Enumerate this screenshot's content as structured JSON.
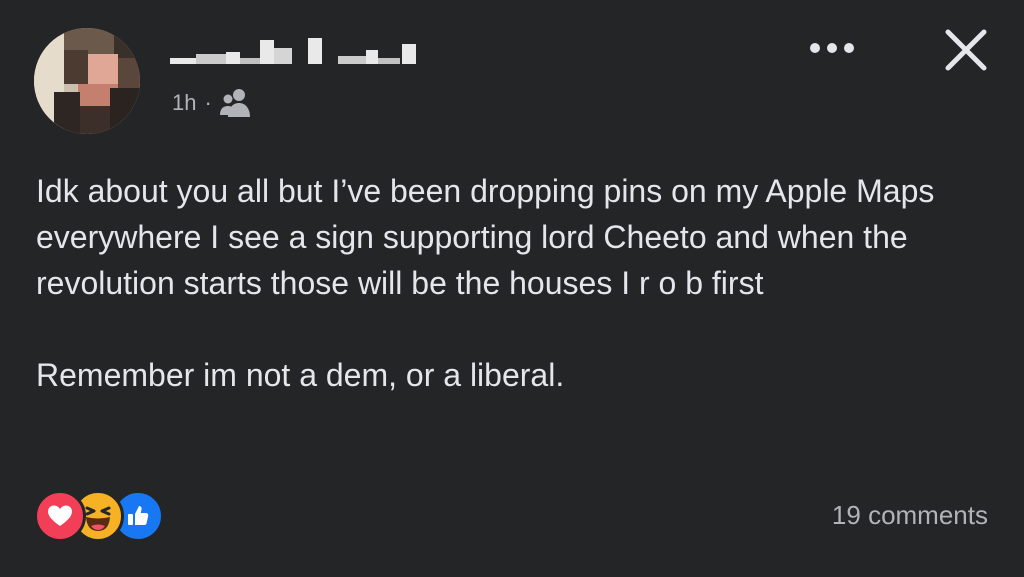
{
  "post": {
    "time": "1h",
    "separator": "·",
    "audience_icon": "friends-icon",
    "text": "Idk about you all but I’ve been dropping pins on my Apple Maps everywhere I see a sign supporting lord Cheeto and when the revolution starts those will be the houses I r o b first\n\nRemember im not a dem, or a liberal."
  },
  "header": {
    "more_icon": "more-options-icon",
    "close_icon": "close-icon"
  },
  "footer": {
    "reactions": [
      "love-reaction-icon",
      "haha-reaction-icon",
      "like-reaction-icon"
    ],
    "comments": "19 comments"
  },
  "colors": {
    "background": "#242526",
    "primary_text": "#e4e6eb",
    "secondary_text": "#b0b3b8",
    "love": "#f33e58",
    "haha": "#f7b125",
    "like": "#1877f2"
  }
}
